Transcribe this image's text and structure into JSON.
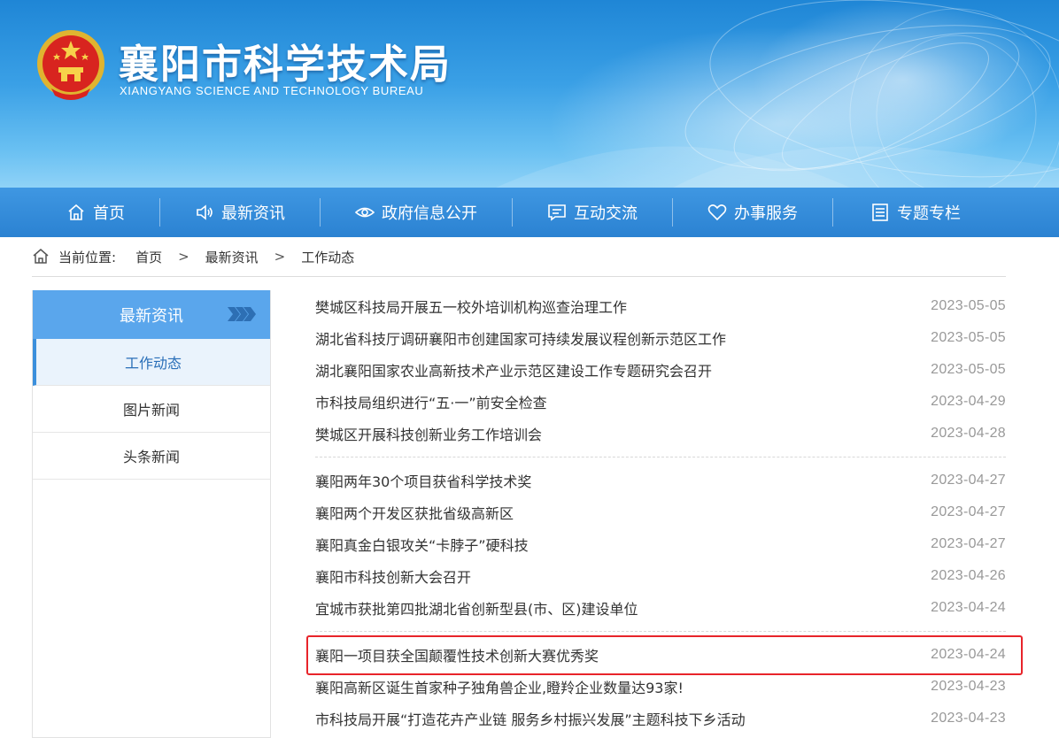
{
  "banner": {
    "title": "襄阳市科学技术局",
    "subtitle": "XIANGYANG SCIENCE AND TECHNOLOGY BUREAU"
  },
  "nav": {
    "items": [
      {
        "label": "首页",
        "icon": "home-icon"
      },
      {
        "label": "最新资讯",
        "icon": "speaker-icon"
      },
      {
        "label": "政府信息公开",
        "icon": "eye-icon"
      },
      {
        "label": "互动交流",
        "icon": "message-icon"
      },
      {
        "label": "办事服务",
        "icon": "heart-icon"
      },
      {
        "label": "专题专栏",
        "icon": "document-icon"
      }
    ]
  },
  "breadcrumb": {
    "label": "当前位置:",
    "items": [
      "首页",
      "最新资讯",
      "工作动态"
    ],
    "separator": ">"
  },
  "sidebar": {
    "header": "最新资讯",
    "items": [
      {
        "label": "工作动态",
        "active": true
      },
      {
        "label": "图片新闻",
        "active": false
      },
      {
        "label": "头条新闻",
        "active": false
      }
    ]
  },
  "news": [
    {
      "title": "樊城区科技局开展五一校外培训机构巡查治理工作",
      "date": "2023-05-05"
    },
    {
      "title": "湖北省科技厅调研襄阳市创建国家可持续发展议程创新示范区工作",
      "date": "2023-05-05"
    },
    {
      "title": "湖北襄阳国家农业高新技术产业示范区建设工作专题研究会召开",
      "date": "2023-05-05"
    },
    {
      "title": "市科技局组织进行“五·一”前安全检查",
      "date": "2023-04-29"
    },
    {
      "title": "樊城区开展科技创新业务工作培训会",
      "date": "2023-04-28"
    },
    {
      "title": "襄阳两年30个项目获省科学技术奖",
      "date": "2023-04-27"
    },
    {
      "title": "襄阳两个开发区获批省级高新区",
      "date": "2023-04-27"
    },
    {
      "title": "襄阳真金白银攻关“卡脖子”硬科技",
      "date": "2023-04-27"
    },
    {
      "title": "襄阳市科技创新大会召开",
      "date": "2023-04-26"
    },
    {
      "title": "宜城市获批第四批湖北省创新型县(市、区)建设单位",
      "date": "2023-04-24"
    },
    {
      "title": "襄阳一项目获全国颠覆性技术创新大赛优秀奖",
      "date": "2023-04-24"
    },
    {
      "title": "襄阳高新区诞生首家种子独角兽企业,瞪羚企业数量达93家!",
      "date": "2023-04-23"
    },
    {
      "title": "市科技局开展“打造花卉产业链 服务乡村振兴发展”主题科技下乡活动",
      "date": "2023-04-23"
    }
  ],
  "colors": {
    "nav_background": "#2b82d2",
    "sidebar_header": "#5aa6ec",
    "highlight_border": "#e8242a",
    "date_text": "#999999"
  }
}
